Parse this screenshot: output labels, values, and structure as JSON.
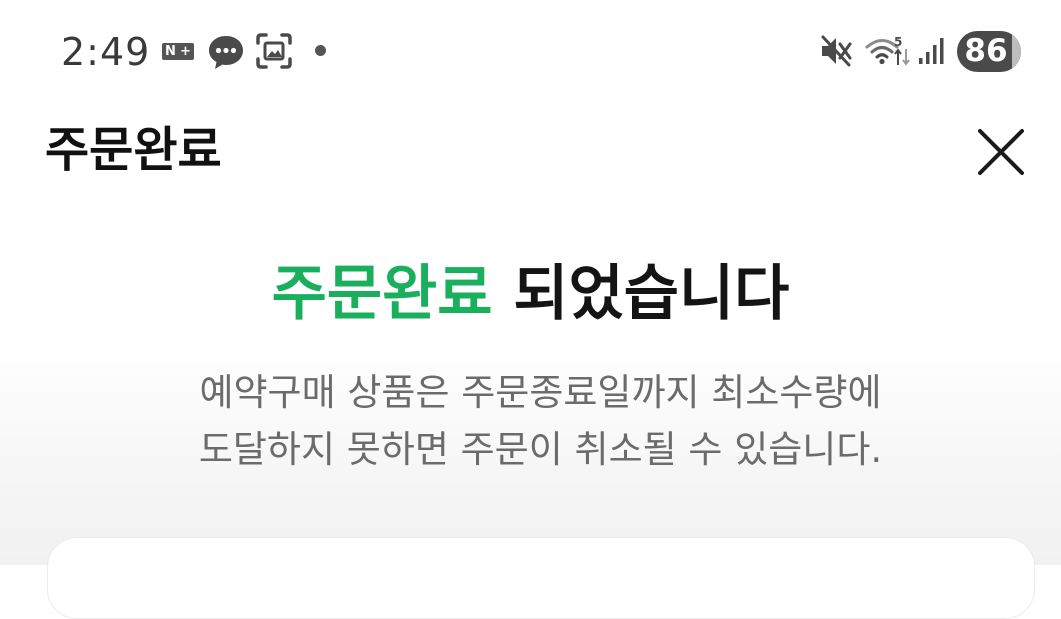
{
  "status_bar": {
    "time": "2:49",
    "nplus_label": "N+",
    "battery_level": "86",
    "wifi_label": "5",
    "icons": [
      "nplus-icon",
      "chat-icon",
      "screenshot-icon",
      "dot-icon",
      "mute-icon",
      "wifi-icon",
      "signal-icon",
      "battery-icon"
    ]
  },
  "header": {
    "title": "주문완료",
    "close_icon": "close-icon"
  },
  "main": {
    "headline_accent": "주문완료",
    "headline_rest": "되었습니다",
    "notice_line1": "예약구매 상품은 주문종료일까지 최소수량에",
    "notice_line2": "도달하지 못하면 주문이 취소될 수 있습니다."
  },
  "colors": {
    "accent": "#1aaf5d",
    "text": "#141414",
    "muted": "#6b6b6b"
  }
}
